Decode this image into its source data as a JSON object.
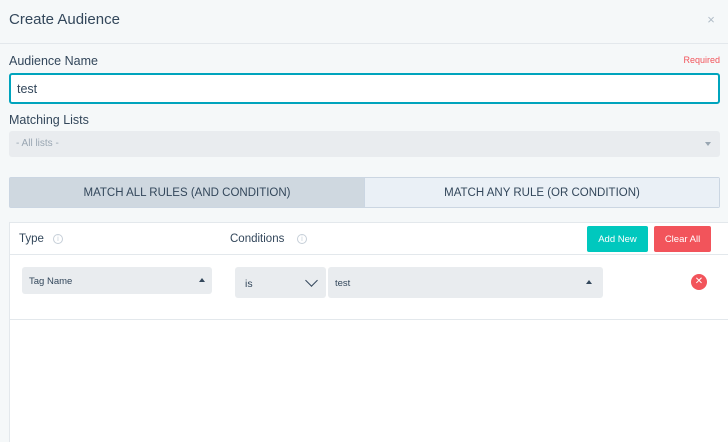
{
  "modal": {
    "title": "Create Audience",
    "close_glyph": "×"
  },
  "form": {
    "audience_name_label": "Audience Name",
    "required_label": "Required",
    "audience_name_value": "test",
    "matching_lists_label": "Matching Lists",
    "matching_lists_value": "- All lists -"
  },
  "match_toggle": {
    "all_label": "MATCH ALL RULES (AND CONDITION)",
    "any_label": "MATCH ANY RULE (OR CONDITION)",
    "selected": "all"
  },
  "rules": {
    "type_header": "Type",
    "conditions_header": "Conditions",
    "info_glyph": "i",
    "add_new_label": "Add New",
    "clear_all_label": "Clear All",
    "rows": [
      {
        "type": "Tag Name",
        "operator": "is",
        "value": "test",
        "remove_glyph": "✕"
      }
    ]
  },
  "colors": {
    "accent": "#00a4bd",
    "add_button": "#00c8be",
    "danger": "#f2545b"
  },
  "icons": [
    "close-icon",
    "chevron-down-icon",
    "info-icon",
    "remove-icon"
  ]
}
